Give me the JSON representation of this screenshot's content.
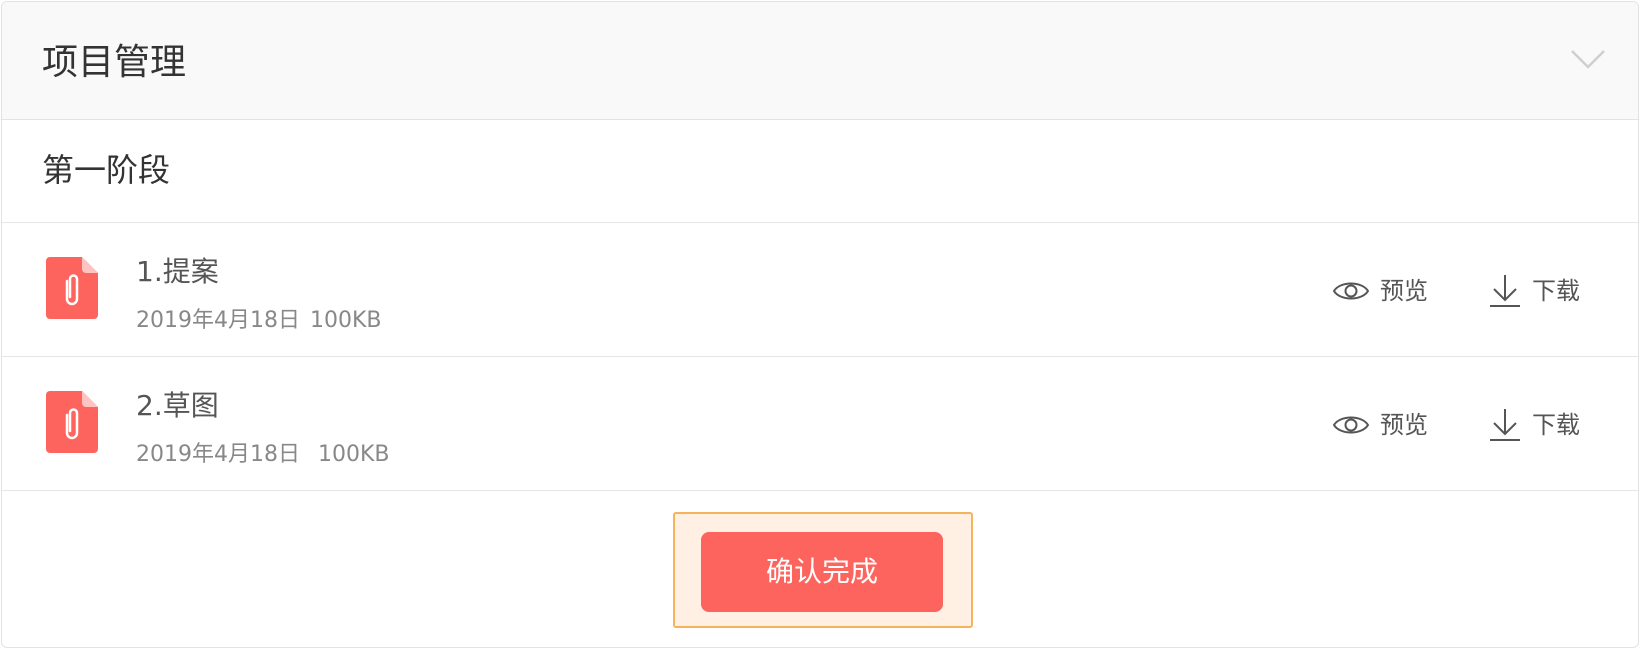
{
  "header": {
    "title": "项目管理",
    "collapse_icon": "chevron-down-icon"
  },
  "stage": {
    "title": "第一阶段"
  },
  "files": [
    {
      "name": "1.提案",
      "date": "2019年4月18日",
      "size": "100KB",
      "icon": "paperclip-file-icon",
      "preview_label": "预览",
      "download_label": "下载"
    },
    {
      "name": "2.草图",
      "date": "2019年4月18日",
      "size": "100KB",
      "icon": "paperclip-file-icon",
      "preview_label": "预览",
      "download_label": "下载"
    }
  ],
  "footer": {
    "confirm_label": "确认完成"
  },
  "colors": {
    "accent": "#FD645D",
    "highlight_bg": "#FFF0E3",
    "highlight_border": "#F6B35B",
    "file_icon": "#FD645D",
    "header_bg": "#F9F9F9"
  }
}
